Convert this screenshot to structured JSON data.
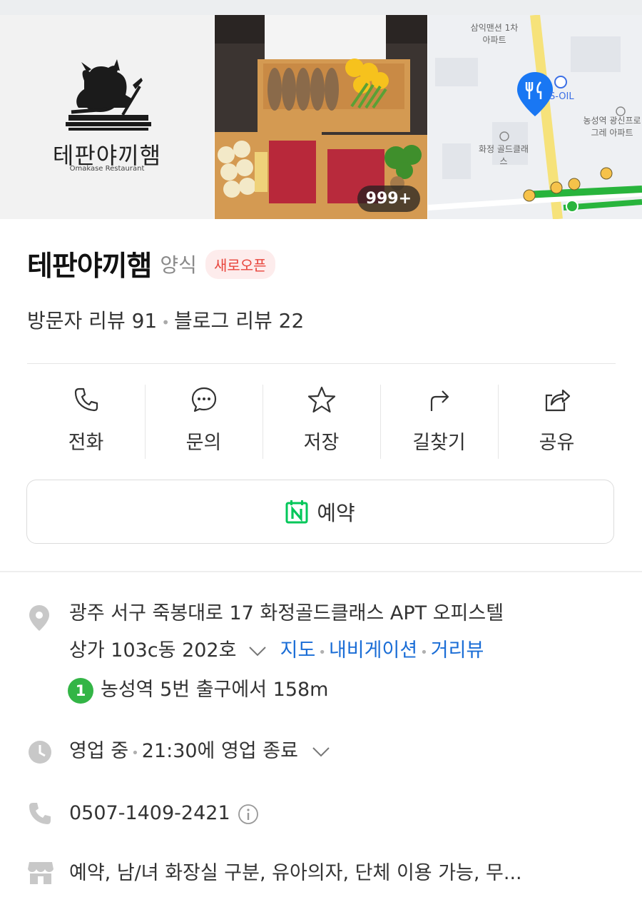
{
  "gallery": {
    "logo_name": "테판야끼햄",
    "logo_sub": "Omakase Restaurant",
    "photo_count": "999+",
    "map_labels": [
      "삼익맨션 1차아파트",
      "S-OIL",
      "농성역 광신프로그레 아파트",
      "화정 골드클래스"
    ]
  },
  "place": {
    "name": "테판야끼햄",
    "category": "양식",
    "badge": "새로오픈",
    "visitor_reviews": "방문자 리뷰 91",
    "blog_reviews": "블로그 리뷰 22"
  },
  "actions": [
    {
      "label": "전화",
      "icon": "phone-icon"
    },
    {
      "label": "문의",
      "icon": "chat-icon"
    },
    {
      "label": "저장",
      "icon": "star-icon"
    },
    {
      "label": "길찾기",
      "icon": "directions-icon"
    },
    {
      "label": "공유",
      "icon": "share-icon"
    }
  ],
  "reserve": {
    "label": "예약",
    "icon": "naver-calendar-icon",
    "accent": "#03c75a"
  },
  "info": {
    "address_line1": "광주 서구 죽봉대로 17 화정골드클래스 APT 오피스텔",
    "address_line2": "상가 103c동 202호",
    "map_link": "지도",
    "navigation_link": "내비게이션",
    "street_view_link": "거리뷰",
    "subway_line": "1",
    "subway_text": "농성역 5번 출구에서 158m",
    "status": "영업 중",
    "hours": "21:30에 영업 종료",
    "phone": "0507-1409-2421",
    "amenities": "예약, 남/녀 화장실 구분, 유아의자, 단체 이용 가능, 무..."
  },
  "colors": {
    "link_blue": "#1a6dd6",
    "badge_red": "#e8453c",
    "subway_green": "#33b546"
  }
}
